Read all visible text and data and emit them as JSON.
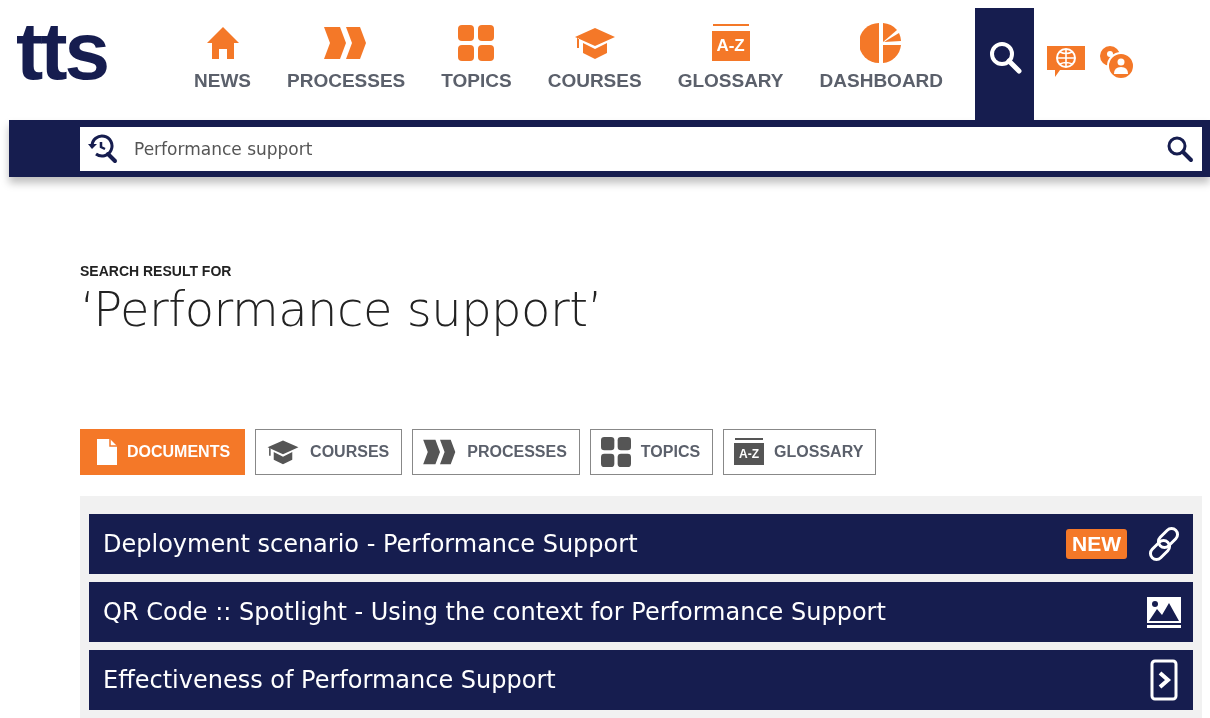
{
  "logo": "tts",
  "nav": [
    {
      "kind": "house",
      "label": "NEWS"
    },
    {
      "kind": "chevrons",
      "label": "PROCESSES"
    },
    {
      "kind": "tiles",
      "label": "TOPICS"
    },
    {
      "kind": "cap",
      "label": "COURSES"
    },
    {
      "kind": "calendar",
      "label": "GLOSSARY",
      "icon_text": "A-Z"
    },
    {
      "kind": "pie",
      "label": "DASHBOARD"
    }
  ],
  "search": {
    "value": "Performance support"
  },
  "heading": {
    "caption": "SEARCH RESULT FOR",
    "query": "‘Performance support’"
  },
  "tabs": [
    {
      "kind": "document",
      "label": "DOCUMENTS",
      "selected": true
    },
    {
      "kind": "cap",
      "label": "COURSES",
      "selected": false
    },
    {
      "kind": "chevrons",
      "label": "PROCESSES",
      "selected": false
    },
    {
      "kind": "tiles",
      "label": "TOPICS",
      "selected": false
    },
    {
      "kind": "calendar",
      "label": "GLOSSARY",
      "icon_text": "A-Z",
      "selected": false
    }
  ],
  "results": [
    {
      "kind": "link",
      "title": "Deployment scenario - Performance Support",
      "badge": "NEW"
    },
    {
      "kind": "image",
      "title": "QR Code :: Spotlight - Using the context for Performance Support"
    },
    {
      "kind": "page",
      "title": "Effectiveness of Performance Support"
    }
  ]
}
